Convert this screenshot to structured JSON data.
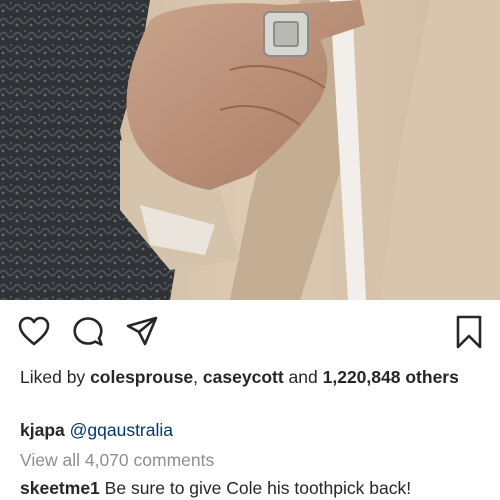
{
  "photo": {
    "icon": "post-photo"
  },
  "actions": {
    "like_icon": "heart-icon",
    "comment_icon": "comment-icon",
    "share_icon": "paper-plane-icon",
    "save_icon": "bookmark-icon"
  },
  "likes": {
    "prefix": "Liked by",
    "user1": "colesprouse",
    "separator": ",",
    "user2": "caseycott",
    "and": "and",
    "count": "1,220,848",
    "others": "others"
  },
  "caption": {
    "username": "kjapa",
    "text": "@gqaustralia"
  },
  "comments_link": "View all 4,070 comments",
  "comment": {
    "username": "skeetme1",
    "text": "Be sure to give Cole his toothpick back!"
  },
  "colors": {
    "text": "#262626",
    "muted": "#8e8e8e",
    "mention": "#00376b"
  }
}
